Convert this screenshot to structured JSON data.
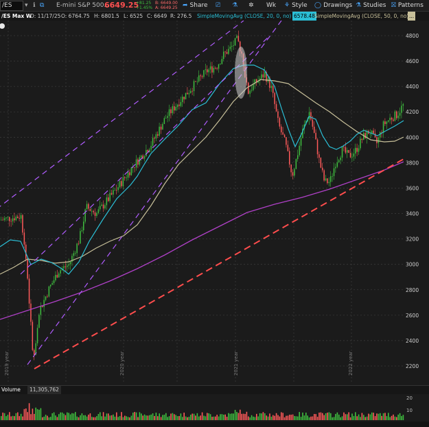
{
  "toolbar": {
    "symbol": "/ES",
    "description": "E-mini S&P 500...",
    "last_price": "6649.25",
    "change_abs": "+81.25",
    "change_pct": "+1.45%",
    "bid": "B: 6649.00",
    "ask": "A: 6649.25",
    "share_label": "Share",
    "timeframe_label": "Wk",
    "style_label": "Style",
    "drawings_label": "Drawings",
    "studies_label": "Studies",
    "patterns_label": "Patterns"
  },
  "infobar": {
    "title": "/ES Max W",
    "date": "D: 11/17/25",
    "open": "O: 6764.75",
    "high": "H: 6801.5",
    "low": "L: 6525",
    "close": "C: 6649",
    "range": "R: 276.5",
    "sma20_label": "SimpleMovingAvg (CLOSE, 20, 0, no)",
    "sma20_value": "6578.48",
    "sma50_label": "SimpleMovingAvg (CLOSE, 50, 0, no)",
    "sma50_value": "..."
  },
  "price_axis": {
    "ticks": [
      "4800",
      "4600",
      "4400",
      "4200",
      "4000",
      "3800",
      "3600",
      "3400",
      "3200",
      "3000",
      "2800",
      "2600",
      "2400",
      "2200"
    ]
  },
  "time_axis": {
    "labels": [
      "2019 year",
      "2020 year",
      "2021 year",
      "2022 year"
    ]
  },
  "volume": {
    "label": "Volume",
    "value": "11,305,762",
    "ticks": [
      "20",
      "10"
    ]
  },
  "colors": {
    "up": "#3fbf3f",
    "down": "#ff5a5a",
    "sma20": "#2bbfd6",
    "sma50": "#c8c09a",
    "sma200": "#b040c8",
    "channel": "#b05cff",
    "trend": "#ff4d4d"
  }
}
